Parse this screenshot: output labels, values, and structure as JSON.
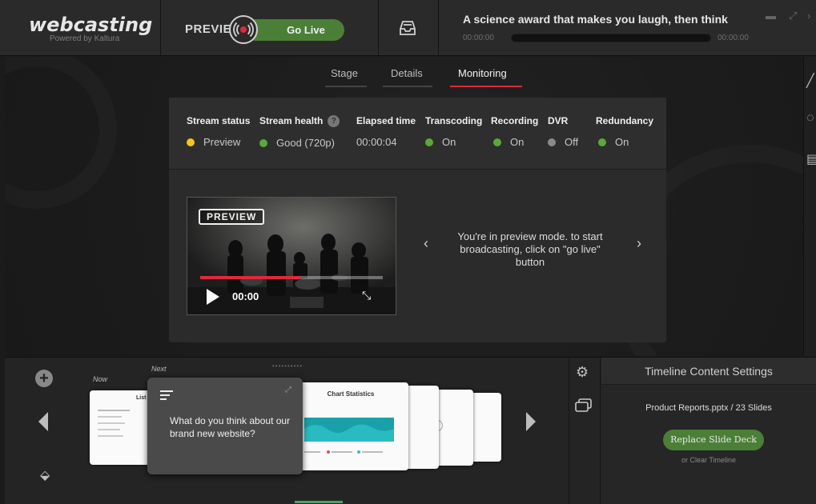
{
  "app": {
    "logo": "webcasting",
    "logo_sub": "Powered by Kaltura",
    "preview_label": "PREVIEW",
    "go_live_label": "Go Live",
    "event_title": "A science award that makes you laugh, then think",
    "time_start": "00:00:00",
    "time_end": "00:00:00",
    "colors": {
      "accent_green": "#4b7f37",
      "live_red": "#e0293b",
      "tab_underline": "#e0293b"
    }
  },
  "tabs": [
    {
      "label": "Stage",
      "active": false
    },
    {
      "label": "Details",
      "active": false
    },
    {
      "label": "Monitoring",
      "active": true
    }
  ],
  "monitoring": {
    "columns": [
      {
        "header": "Stream status",
        "value": "Preview",
        "dot": "#f5c518",
        "help": false
      },
      {
        "header": "Stream health",
        "value": "Good (720p)",
        "dot": "#5aa83a",
        "help": true
      },
      {
        "header": "Elapsed time",
        "value": "00:00:04",
        "dot": null,
        "help": false
      },
      {
        "header": "Transcoding",
        "value": "On",
        "dot": "#5aa83a",
        "help": false
      },
      {
        "header": "Recording",
        "value": "On",
        "dot": "#5aa83a",
        "help": false
      },
      {
        "header": "DVR",
        "value": "Off",
        "dot": "#8a8a8a",
        "help": false
      },
      {
        "header": "Redundancy",
        "value": "On",
        "dot": "#5aa83a",
        "help": false
      }
    ],
    "help_glyph": "?"
  },
  "video": {
    "badge": "PREVIEW",
    "time": "00:00",
    "progress": 0.55
  },
  "preview_message": "You're in preview mode. to start broadcasting, click on \"go live\" button",
  "timeline": {
    "now_label": "Now",
    "next_label": "Next",
    "current_question": "What do you think about our brand new website?",
    "chart_slide_title": "Chart Statistics",
    "list_slide_title": "List I"
  },
  "settings": {
    "title": "Timeline Content Settings",
    "file": "Product Reports.pptx / 23 Slides",
    "replace_label": "Replace Slide Deck",
    "clear_label": "or Clear Timeline"
  }
}
